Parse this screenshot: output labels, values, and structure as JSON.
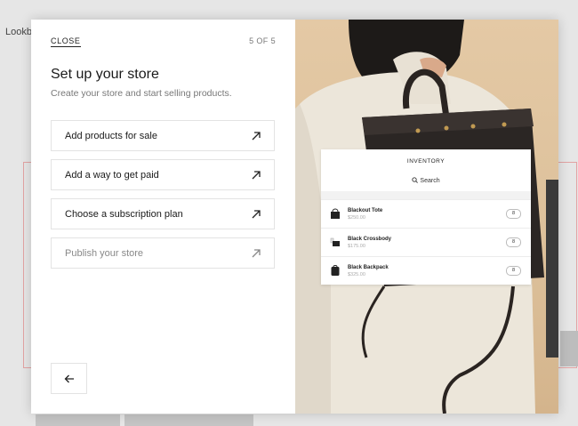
{
  "background": {
    "label": "Lookb"
  },
  "modal": {
    "close_label": "CLOSE",
    "step": "5 OF 5",
    "title": "Set up your store",
    "subtitle": "Create your store and start selling products.",
    "tasks": [
      {
        "label": "Add products for sale",
        "state": "active"
      },
      {
        "label": "Add a way to get paid",
        "state": "active"
      },
      {
        "label": "Choose a subscription plan",
        "state": "active"
      },
      {
        "label": "Publish your store",
        "state": "muted"
      }
    ],
    "back_icon": "arrow-left-icon"
  },
  "inventory": {
    "title": "INVENTORY",
    "search_label": "Search",
    "items": [
      {
        "name": "Blackout Tote",
        "price": "$250.00",
        "qty": "8"
      },
      {
        "name": "Black Crossbody",
        "price": "$175.00",
        "qty": "8"
      },
      {
        "name": "Black Backpack",
        "price": "$325.00",
        "qty": "8"
      }
    ]
  }
}
